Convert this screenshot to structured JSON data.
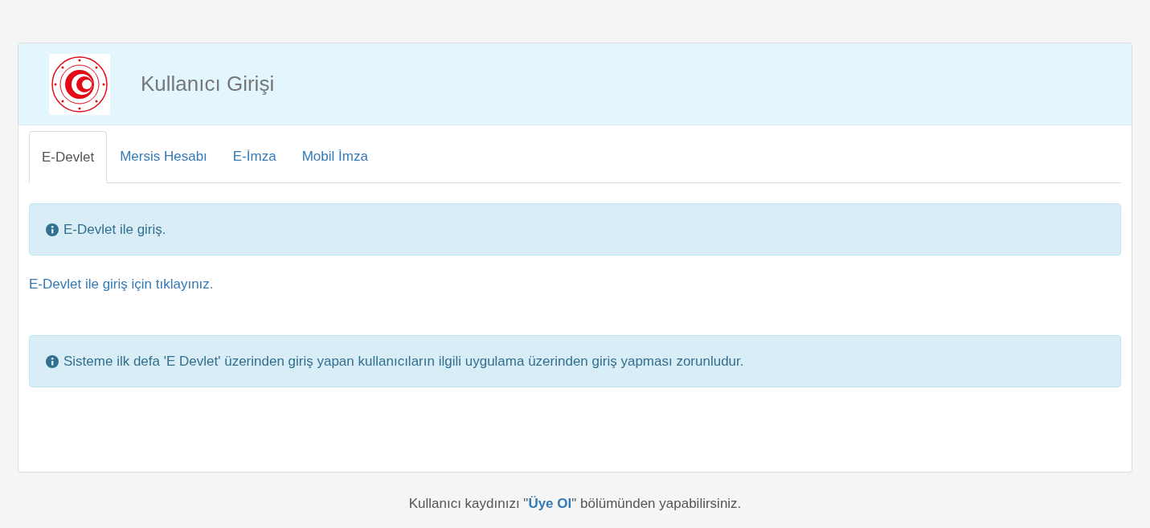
{
  "header": {
    "title": "Kullanıcı Girişi"
  },
  "tabs": [
    {
      "label": "E-Devlet",
      "selected": true
    },
    {
      "label": "Mersis Hesabı",
      "selected": false
    },
    {
      "label": "E-İmza",
      "selected": false
    },
    {
      "label": "Mobil İmza",
      "selected": false
    }
  ],
  "info_alert": "E-Devlet ile giriş.",
  "login_link": "E-Devlet ile giriş için tıklayınız.",
  "notice_alert": "Sisteme ilk defa 'E Devlet' üzerinden giriş yapan kullanıcıların ilgili uygulama üzerinden giriş yapması zorunludur.",
  "footer": {
    "before": "Kullanıcı kaydınızı \"",
    "link": "Üye Ol",
    "after": "\" bölümünden yapabilirsiniz."
  }
}
